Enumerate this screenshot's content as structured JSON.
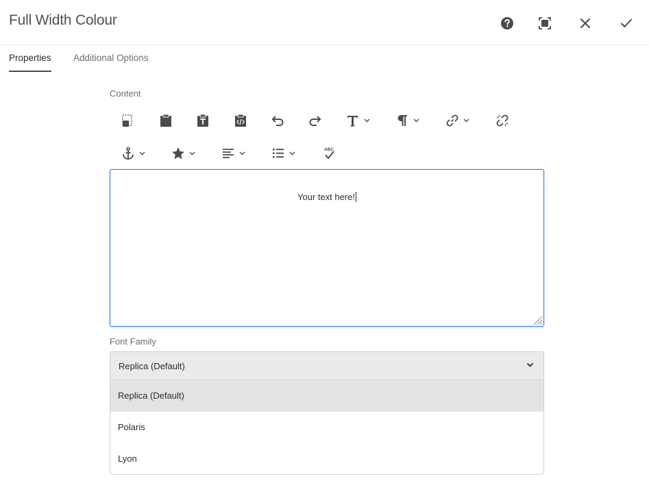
{
  "dialog": {
    "title": "Full Width Colour",
    "header_icons": [
      "help-icon",
      "fullscreen-icon",
      "close-icon",
      "checkmark-icon"
    ]
  },
  "tabs": [
    {
      "label": "Properties",
      "active": true
    },
    {
      "label": "Additional Options",
      "active": false
    }
  ],
  "content": {
    "label": "Content",
    "toolbar_row1": [
      "paste-icon",
      "paste-plain-icon",
      "paste-text-icon",
      "paste-wordhtml-icon",
      "undo-icon",
      "redo-icon",
      "text-format-icon",
      "paragraph-icon",
      "link-icon",
      "unlink-icon"
    ],
    "toolbar_row2": [
      "anchor-icon",
      "star-icon",
      "align-icon",
      "list-icon",
      "spellcheck-icon"
    ],
    "spellcheck_glyph": "ABC",
    "editor_text": "Your text here!"
  },
  "font_family": {
    "label": "Font Family",
    "selected": "Replica (Default)",
    "options": [
      "Replica (Default)",
      "Polaris",
      "Lyon"
    ]
  },
  "colors": {
    "accent": "#2680eb",
    "icon": "#4b4b4b",
    "select_bg": "#eaeaea",
    "option_selected_bg": "#e3e3e3"
  }
}
